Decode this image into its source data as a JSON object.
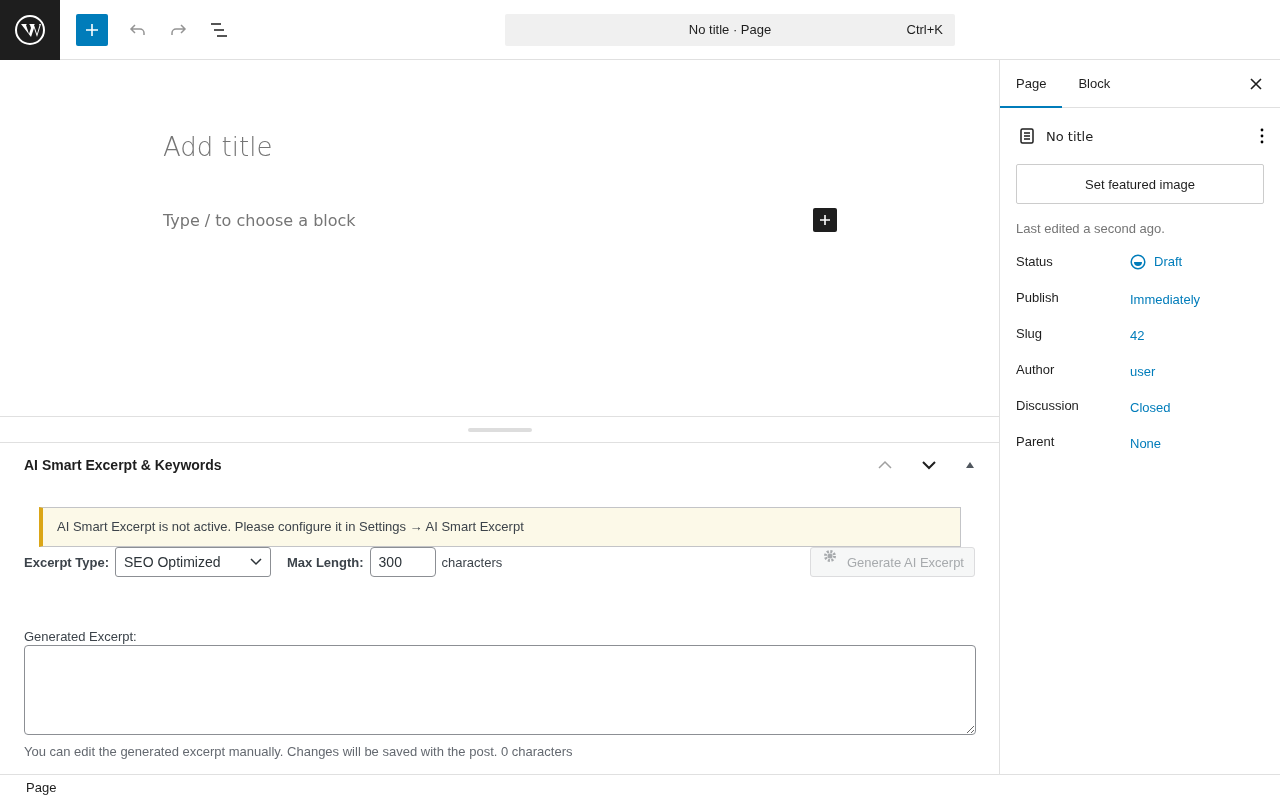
{
  "toolbar": {
    "command_bar": {
      "title": "No title · Page",
      "shortcut": "Ctrl+K"
    }
  },
  "editor": {
    "title_placeholder": "Add title",
    "block_placeholder": "Type / to choose a block"
  },
  "meta_box": {
    "title": "AI Smart Excerpt & Keywords",
    "notice": "AI Smart Excerpt is not active. Please configure it in Settings → AI Smart Excerpt",
    "excerpt_type": {
      "label": "Excerpt Type:",
      "value": "SEO Optimized"
    },
    "max_length": {
      "label": "Max Length:",
      "value": "300",
      "unit": "characters"
    },
    "generate_button": {
      "label": "Generate AI Excerpt",
      "disabled": true
    },
    "generated": {
      "label": "Generated Excerpt:",
      "help": "You can edit the generated excerpt manually. Changes will be saved with the post. 0 characters"
    }
  },
  "sidebar": {
    "tabs": [
      {
        "label": "Page",
        "selected": true
      },
      {
        "label": "Block",
        "selected": false
      }
    ],
    "doc_title": "No title",
    "featured_button": "Set featured image",
    "last_edited": "Last edited a second ago.",
    "rows": [
      {
        "label": "Status",
        "value": "Draft",
        "kind": "status"
      },
      {
        "label": "Publish",
        "value": "Immediately",
        "kind": "link"
      },
      {
        "label": "Slug",
        "value": "42",
        "kind": "link"
      },
      {
        "label": "Author",
        "value": "user",
        "kind": "link"
      },
      {
        "label": "Discussion",
        "value": "Closed",
        "kind": "link"
      },
      {
        "label": "Parent",
        "value": "None",
        "kind": "link"
      }
    ]
  },
  "footer": {
    "breadcrumb": "Page"
  }
}
